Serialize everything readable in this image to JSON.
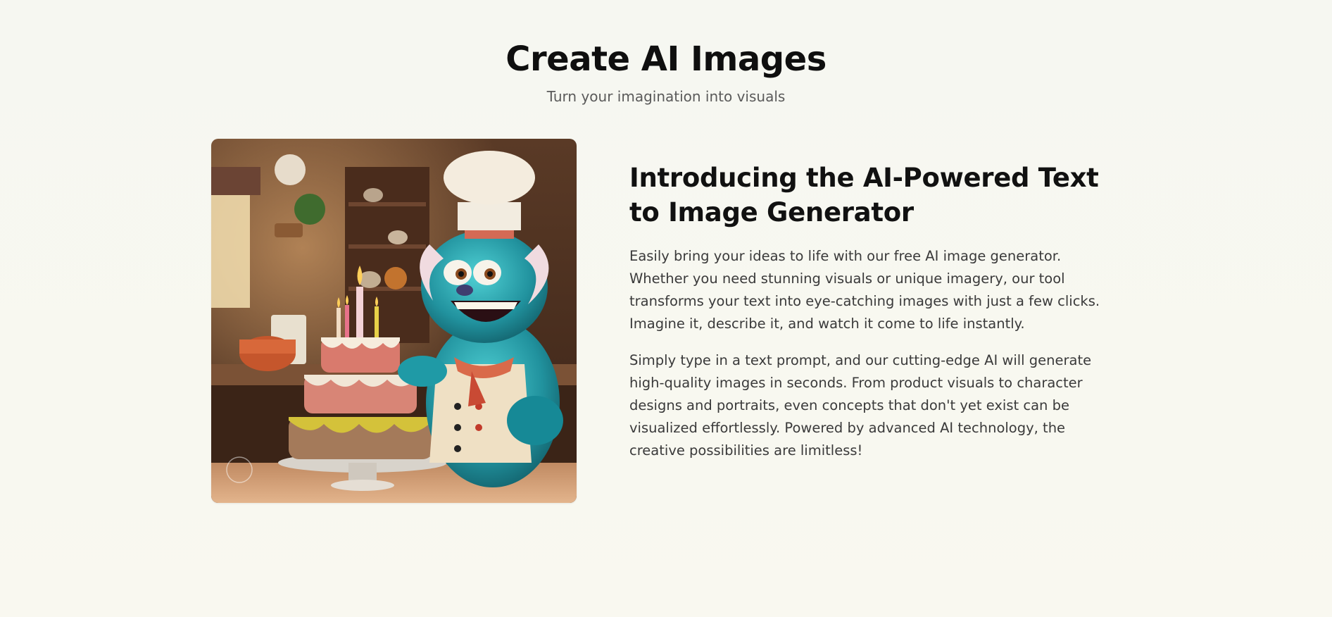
{
  "hero": {
    "title": "Create AI Images",
    "subtitle": "Turn your imagination into visuals"
  },
  "feature": {
    "image_alt": "Blue furry monster chef with a three-tier birthday cake",
    "heading": "Introducing the AI-Powered Text to Image Generator",
    "paragraphs": [
      "Easily bring your ideas to life with our free AI image generator. Whether you need stunning visuals or unique imagery, our tool transforms your text into eye-catching images with just a few clicks. Imagine it, describe it, and watch it come to life instantly.",
      "Simply type in a text prompt, and our cutting-edge AI will generate high-quality images in seconds. From product visuals to character designs and portraits, even concepts that don't yet exist can be visualized effortlessly. Powered by advanced AI technology, the creative possibilities are limitless!"
    ]
  },
  "colors": {
    "background": "#f8f8f2",
    "heading": "#111111",
    "body_text": "#3a3a3a",
    "subtitle": "#5a5a5a"
  }
}
